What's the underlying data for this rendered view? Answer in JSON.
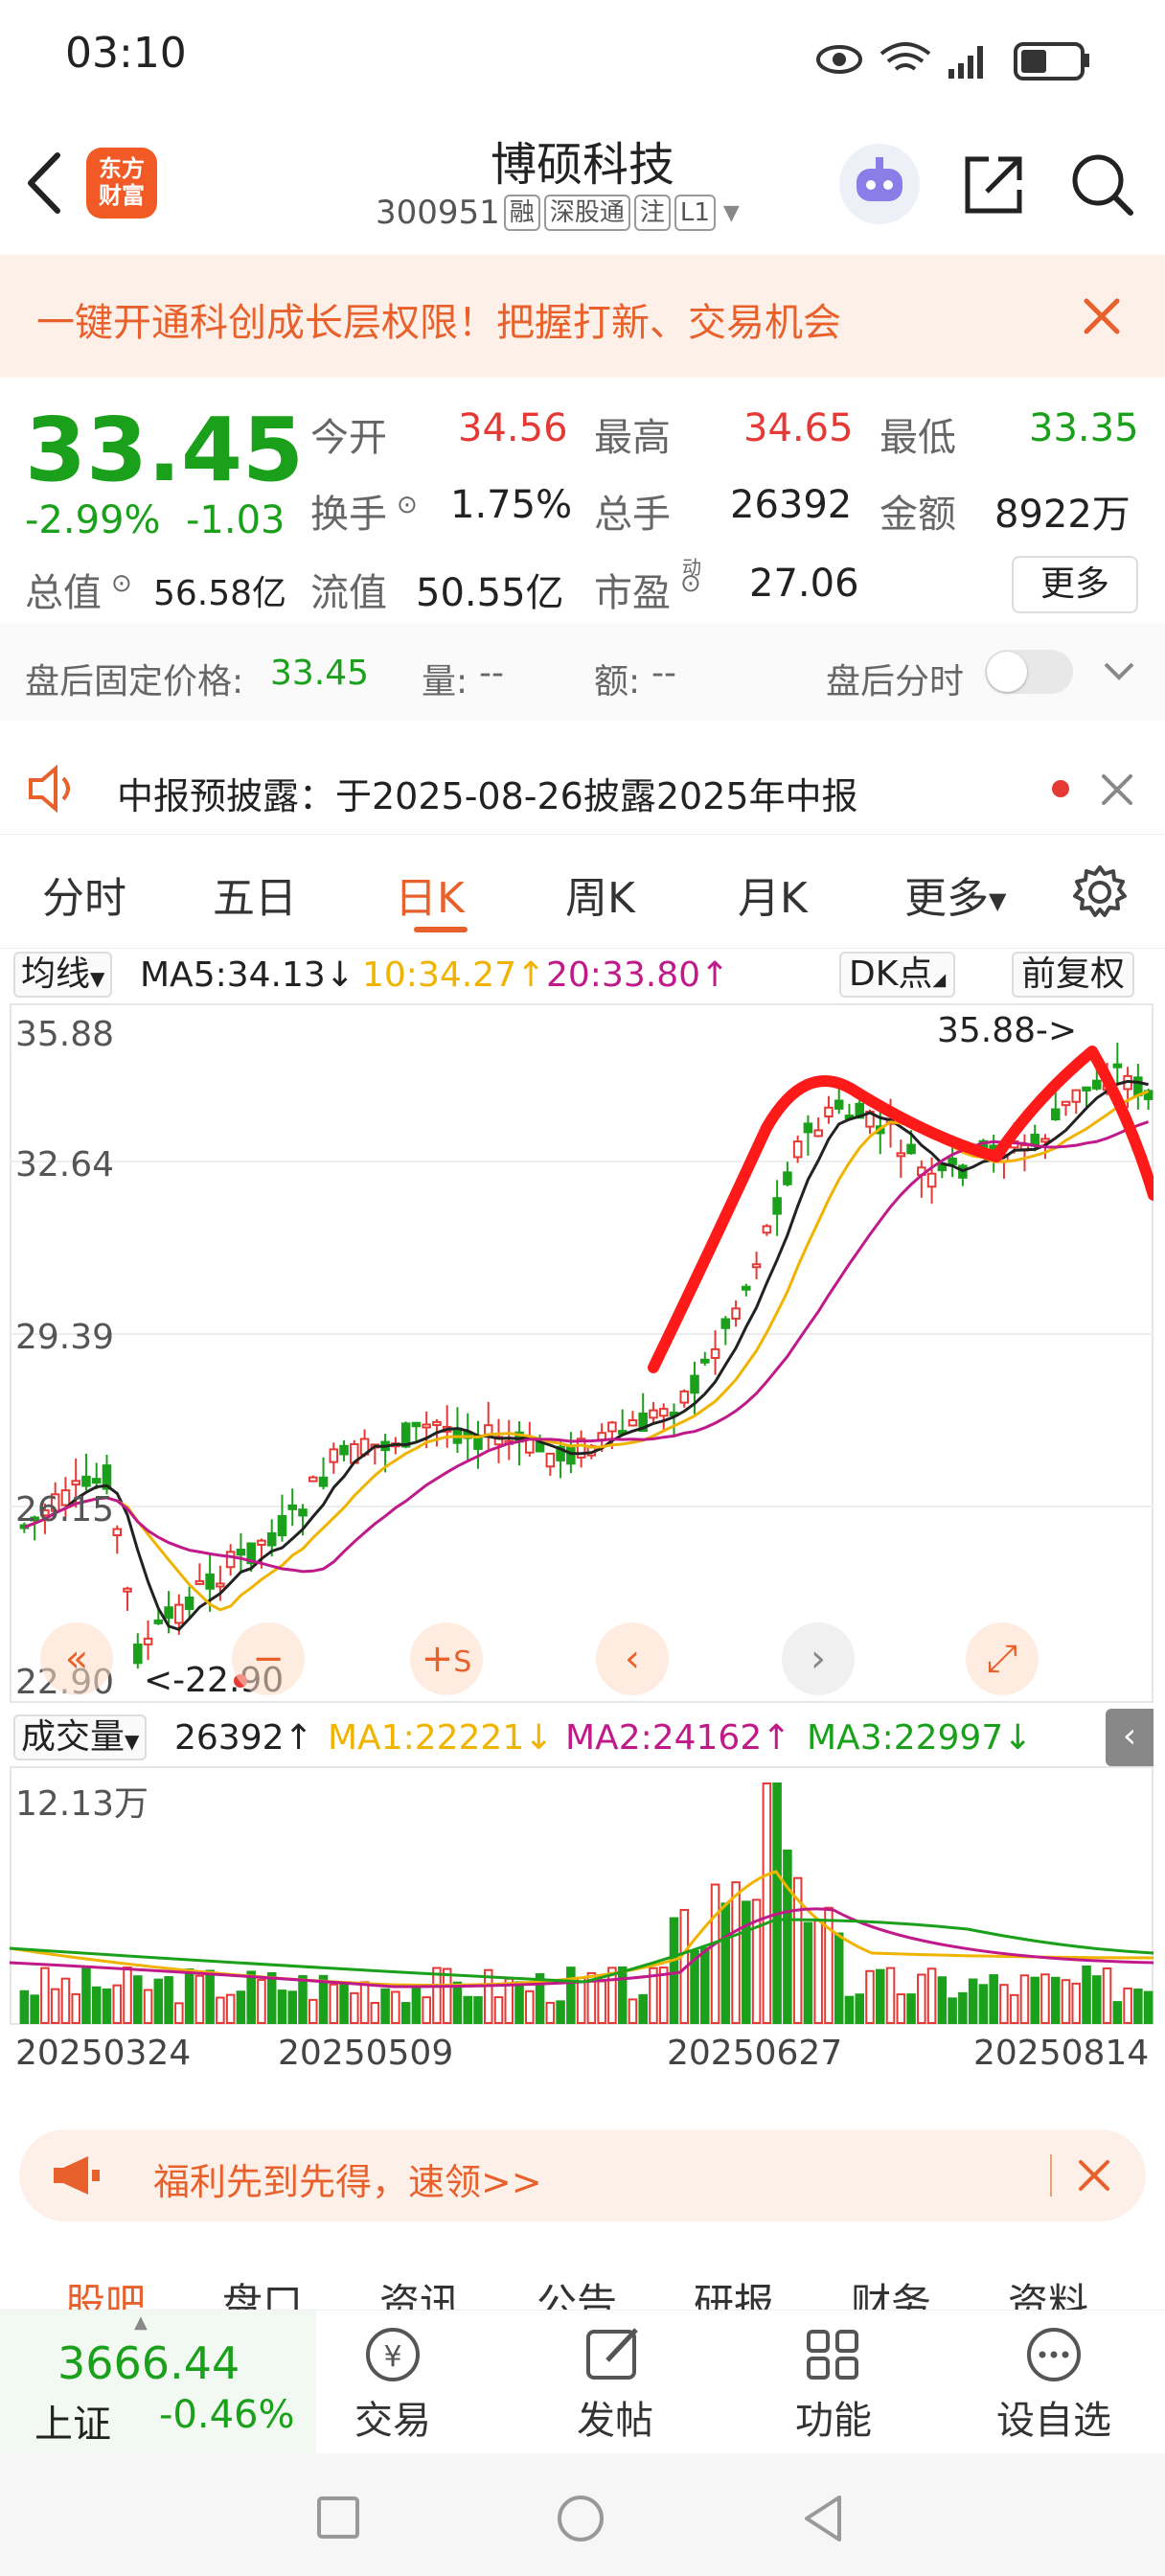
{
  "status": {
    "time": "03:10"
  },
  "header": {
    "title": "博硕科技",
    "code": "300951",
    "tags": [
      "融",
      "深股通",
      "注",
      "L1"
    ],
    "logo_text": "东方\n财富"
  },
  "banner": {
    "text": "一键开通科创成长层权限！把握打新、交易机会"
  },
  "quote": {
    "price": "33.45",
    "change_pct": "-2.99%",
    "change": "-1.03",
    "open_label": "今开",
    "open": "34.56",
    "high_label": "最高",
    "high": "34.65",
    "low_label": "最低",
    "low": "33.35",
    "turnover_label": "换手",
    "turnover": "1.75%",
    "volume_label": "总手",
    "volume": "26392",
    "amount_label": "金额",
    "amount": "8922万",
    "mcap_label": "总值",
    "mcap": "56.58亿",
    "float_label": "流值",
    "float": "50.55亿",
    "pe_label": "市盈",
    "pe_sup": "动",
    "pe": "27.06",
    "more": "更多"
  },
  "after_hours": {
    "price_label": "盘后固定价格:",
    "price": "33.45",
    "vol_label": "量:",
    "vol": "--",
    "amt_label": "额:",
    "amt": "--",
    "split_label": "盘后分时"
  },
  "notice": {
    "text": "中报预披露：于2025-08-26披露2025年中报"
  },
  "tabs": [
    "分时",
    "五日",
    "日K",
    "周K",
    "月K",
    "更多"
  ],
  "ma_row": {
    "select": "均线",
    "ma5": "MA5:34.13↓",
    "ma10": "10:34.27↑",
    "ma20": "20:33.80↑",
    "dk": "DK点",
    "fq": "前复权"
  },
  "chart": {
    "y_labels": [
      "35.88",
      "32.64",
      "29.39",
      "26.15",
      "22.90"
    ],
    "high_note": "35.88->",
    "low_note": "<-22.90"
  },
  "vol_row": {
    "select": "成交量",
    "val": "26392↑",
    "ma1": "MA1:22221↓",
    "ma2": "MA2:24162↑",
    "ma3": "MA3:22997↓"
  },
  "vol_chart": {
    "max_label": "12.13万"
  },
  "dates": [
    "20250324",
    "20250509",
    "20250627",
    "20250814"
  ],
  "promo": {
    "text": "福利先到先得，速领>>"
  },
  "subtabs": [
    "股吧",
    "盘口",
    "资讯",
    "公告",
    "研报",
    "财务",
    "资料"
  ],
  "bottom": {
    "index_value": "3666.44",
    "index_name": "上证",
    "index_change": "-0.46%",
    "items": [
      "交易",
      "发帖",
      "功能",
      "设自选"
    ]
  },
  "colors": {
    "up": "#e53935",
    "down": "#1aa01a",
    "accent": "#e8612c"
  }
}
